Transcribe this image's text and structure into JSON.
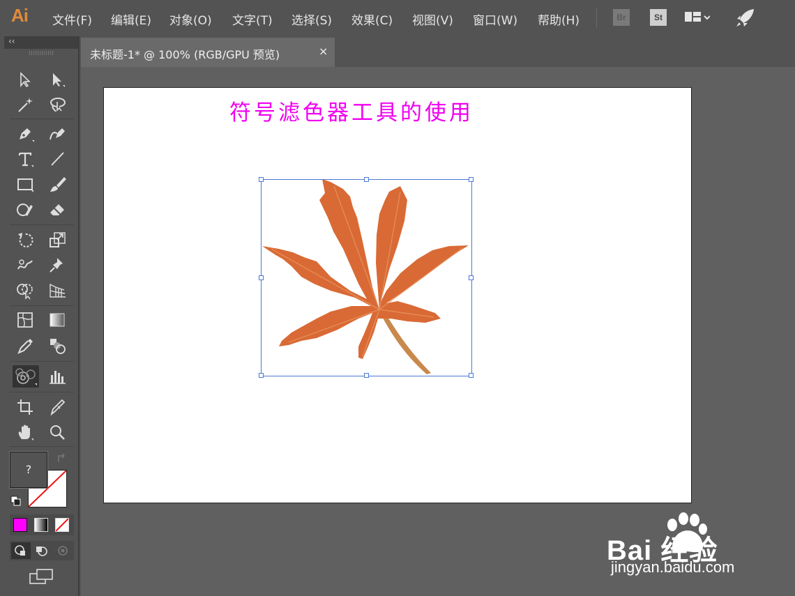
{
  "app": {
    "logo": "Ai",
    "menus": [
      "文件(F)",
      "编辑(E)",
      "对象(O)",
      "文字(T)",
      "选择(S)",
      "效果(C)",
      "视图(V)",
      "窗口(W)",
      "帮助(H)"
    ],
    "right_icons": {
      "bridge": "Br",
      "stock": "St"
    }
  },
  "toolbox": {
    "collapse_label": "‹‹",
    "fill_unknown": "?"
  },
  "document": {
    "tab_label": "未标题-1* @ 100% (RGB/GPU 预览)",
    "close_label": "×"
  },
  "artboard": {
    "title": "符号滤色器工具的使用"
  },
  "watermark": {
    "brand": "Bai  经验",
    "url": "jingyan.baidu.com"
  },
  "colors": {
    "accent_text": "#f000f0",
    "leaf": "#d96a35",
    "selection": "#4a78d6",
    "logo": "#e08a3a"
  }
}
